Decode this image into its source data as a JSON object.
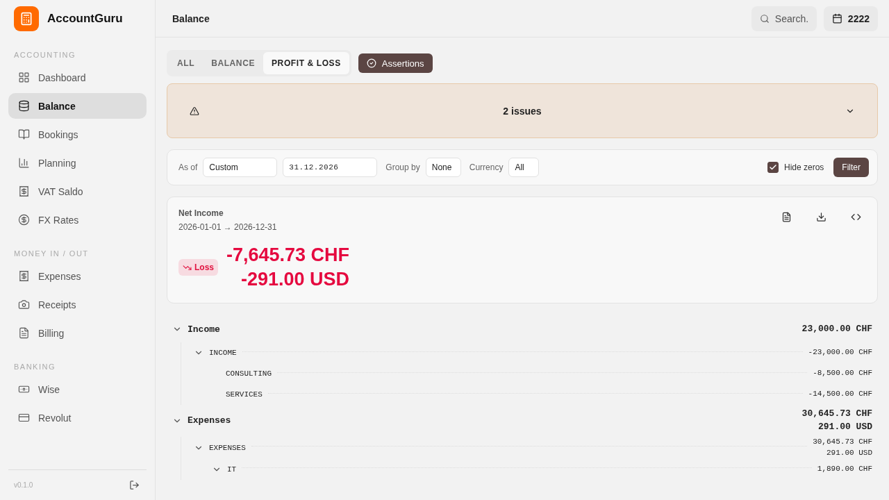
{
  "app": {
    "name": "AccountGuru"
  },
  "sidebar": {
    "sections": [
      {
        "title": "ACCOUNTING",
        "items": [
          {
            "label": "Dashboard",
            "selected": false
          },
          {
            "label": "Balance",
            "selected": true
          },
          {
            "label": "Bookings",
            "selected": false
          },
          {
            "label": "Planning",
            "selected": false
          },
          {
            "label": "VAT Saldo",
            "selected": false
          },
          {
            "label": "FX Rates",
            "selected": false
          }
        ]
      },
      {
        "title": "MONEY IN / OUT",
        "items": [
          {
            "label": "Expenses",
            "selected": false
          },
          {
            "label": "Receipts",
            "selected": false
          },
          {
            "label": "Billing",
            "selected": false
          }
        ]
      },
      {
        "title": "BANKING",
        "items": [
          {
            "label": "Wise",
            "selected": false
          },
          {
            "label": "Revolut",
            "selected": false
          }
        ]
      }
    ],
    "version": "v0.1.0"
  },
  "header": {
    "title": "Balance",
    "search": {
      "placeholder": "Search."
    },
    "year": "2222"
  },
  "tabs": [
    {
      "label": "ALL",
      "selected": false
    },
    {
      "label": "BALANCE",
      "selected": false
    },
    {
      "label": "PROFIT & LOSS",
      "selected": true
    }
  ],
  "assertions_button": "Assertions",
  "issues": {
    "label": "2 issues",
    "expanded": false
  },
  "filters": {
    "as_of_label": "As of",
    "as_of": "Custom",
    "date": "31.12.2026",
    "group_by_label": "Group by",
    "group_by": "None",
    "currency_label": "Currency",
    "currency": "All",
    "hide_zeros": {
      "label": "Hide zeros",
      "checked": true
    },
    "filter_button": "Filter"
  },
  "net_income": {
    "title": "Net Income",
    "period": "2026-01-01 → 2026-12-31",
    "badge": "Loss",
    "amounts": [
      "-7,645.73 CHF",
      "-291.00 USD"
    ]
  },
  "report": [
    {
      "name": "Income",
      "expanded": true,
      "amounts": [
        "23,000.00 CHF"
      ],
      "children": [
        {
          "name": "INCOME",
          "expanded": true,
          "amounts": [
            "-23,000.00 CHF"
          ],
          "children": [
            {
              "name": "CONSULTING",
              "amounts": [
                "-8,500.00 CHF"
              ]
            },
            {
              "name": "SERVICES",
              "amounts": [
                "-14,500.00 CHF"
              ]
            }
          ]
        }
      ]
    },
    {
      "name": "Expenses",
      "expanded": true,
      "amounts": [
        "30,645.73 CHF",
        "291.00 USD"
      ],
      "children": [
        {
          "name": "EXPENSES",
          "expanded": true,
          "amounts": [
            "30,645.73 CHF",
            "291.00 USD"
          ],
          "children": [
            {
              "name": "IT",
              "expanded": true,
              "amounts": [
                "1,890.00 CHF"
              ]
            }
          ]
        }
      ]
    }
  ]
}
